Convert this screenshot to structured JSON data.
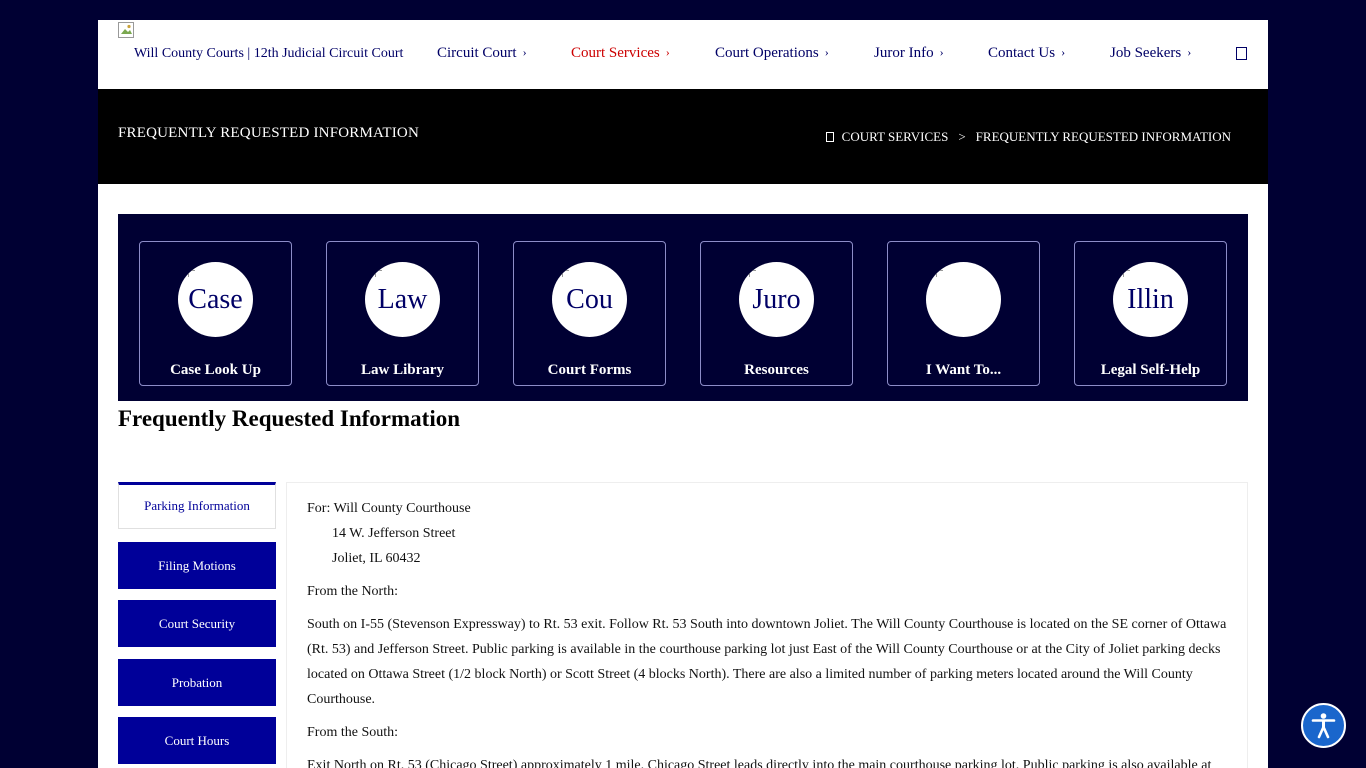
{
  "nav": {
    "site_title": "Will County Courts | 12th Judicial Circuit Court",
    "items": [
      {
        "label": "Circuit Court"
      },
      {
        "label": "Court Services"
      },
      {
        "label": "Court Operations"
      },
      {
        "label": "Juror Info"
      },
      {
        "label": "Contact Us"
      },
      {
        "label": "Job Seekers"
      }
    ],
    "active_color": "#cc0000",
    "search_icon": "search-icon"
  },
  "banner": {
    "title": "FREQUENTLY REQUESTED INFORMATION",
    "breadcrumb": {
      "home_icon": "home-icon",
      "parent": "COURT SERVICES",
      "separator": ">",
      "current": "FREQUENTLY REQUESTED INFORMATION"
    }
  },
  "quick_links": [
    {
      "alt": "Case",
      "label": "Case Look Up"
    },
    {
      "alt": "Law",
      "label": "Law Library"
    },
    {
      "alt": "Cou",
      "label": "Court Forms"
    },
    {
      "alt": "Juro",
      "label": "Resources"
    },
    {
      "alt": "",
      "label": "I Want To..."
    },
    {
      "alt": "Illin",
      "label": "Legal Self-Help"
    }
  ],
  "heading": "Frequently Requested Information",
  "tabs": [
    {
      "label": "Parking Information",
      "active": true
    },
    {
      "label": "Filing Motions"
    },
    {
      "label": "Court Security"
    },
    {
      "label": "Probation"
    },
    {
      "label": "Court Hours"
    }
  ],
  "content": {
    "address": {
      "line1": "For: Will County Courthouse",
      "line2": "14 W. Jefferson Street",
      "line3": "Joliet, IL 60432"
    },
    "north_heading": "From the North:",
    "north_text": "South on I-55 (Stevenson Expressway) to Rt. 53 exit. Follow Rt. 53 South into downtown Joliet. The Will County Courthouse is located on the SE corner of Ottawa (Rt. 53) and Jefferson Street. Public parking is available in the courthouse parking lot just East of the Will County Courthouse or at the City of Joliet parking decks located on Ottawa Street (1/2 block North) or Scott Street (4 blocks North). There are also a limited number of parking meters located around the Will County Courthouse.",
    "south_heading": "From the South:",
    "south_text": "Exit North on Rt. 53 (Chicago Street) approximately 1 mile. Chicago Street leads directly into the main courthouse parking lot. Public parking is also available at"
  },
  "accessibility_icon": "accessibility-icon",
  "colors": {
    "background": "#000033",
    "brand_navy": "#000066",
    "tab_blue": "#000099",
    "accessibility_blue": "#1a66cc"
  }
}
